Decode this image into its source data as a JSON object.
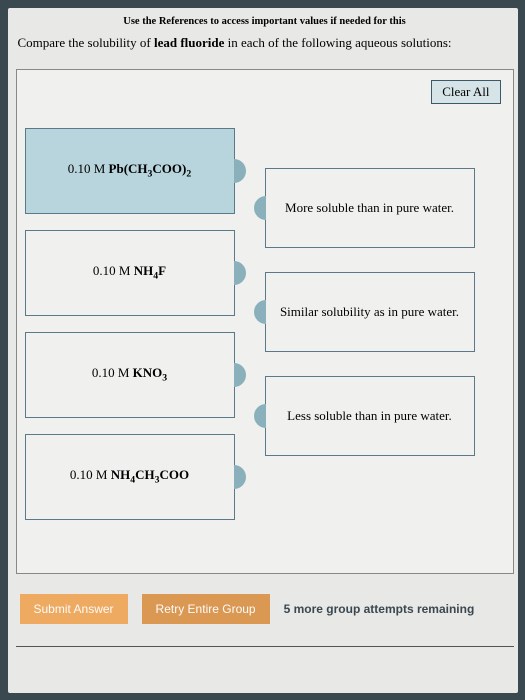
{
  "header": {
    "reference": "Use the References to access important values if needed for this",
    "question_pre": "Compare the solubility of ",
    "question_bold": "lead fluoride",
    "question_post": " in each of the following aqueous solutions:"
  },
  "panel": {
    "clear_label": "Clear All",
    "solutions": [
      {
        "prefix": "0.10 M ",
        "formula": "Pb(CH3COO)2",
        "display": "Pb(CH₃COO)₂",
        "active": true
      },
      {
        "prefix": "0.10 M ",
        "formula": "NH4F",
        "display": "NH₄F",
        "active": false
      },
      {
        "prefix": "0.10 M ",
        "formula": "KNO3",
        "display": "KNO₃",
        "active": false
      },
      {
        "prefix": "0.10 M ",
        "formula": "NH4CH3COO",
        "display": "NH₄CH₃COO",
        "active": false
      }
    ],
    "targets": [
      {
        "label": "More soluble than in pure water."
      },
      {
        "label": "Similar solubility as in pure water."
      },
      {
        "label": "Less soluble than in pure water."
      }
    ]
  },
  "footer": {
    "submit": "Submit Answer",
    "retry": "Retry Entire Group",
    "attempts": "5 more group attempts remaining"
  }
}
